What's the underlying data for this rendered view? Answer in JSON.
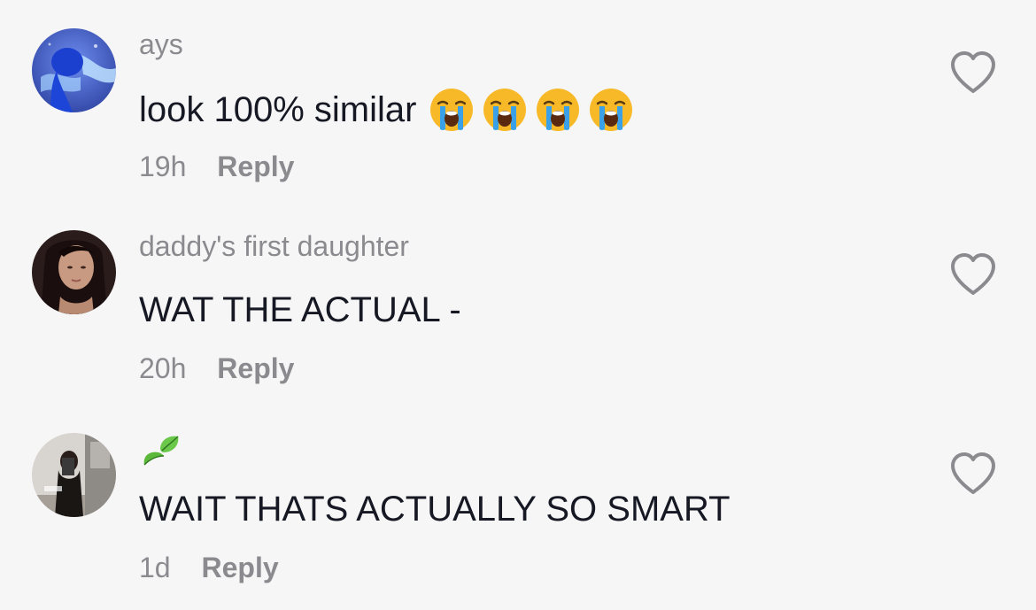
{
  "comments": [
    {
      "username": "ays",
      "text": "look 100% similar",
      "emojis": [
        "loudly-crying-face",
        "loudly-crying-face",
        "loudly-crying-face",
        "loudly-crying-face"
      ],
      "time": "19h",
      "reply_label": "Reply"
    },
    {
      "username": "daddy's first daughter",
      "text": "WAT THE ACTUAL -",
      "time": "20h",
      "reply_label": "Reply"
    },
    {
      "username_icon": "leaf-icon",
      "text": "WAIT THATS ACTUALLY SO SMART",
      "time": "1d",
      "reply_label": "Reply"
    }
  ],
  "colors": {
    "background": "#f6f6f6",
    "primary_text": "#161823",
    "secondary_text": "#8a8a8f",
    "heart_outline": "#8a8a8f"
  }
}
